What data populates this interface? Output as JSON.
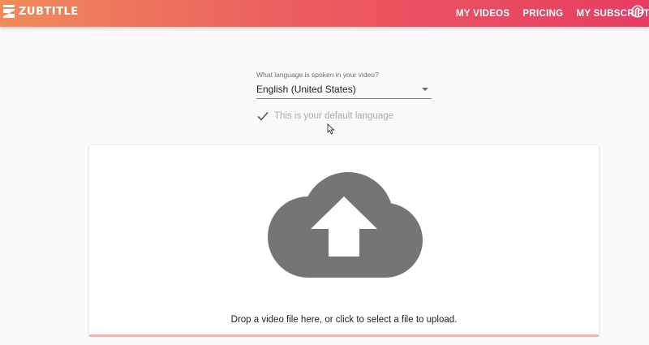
{
  "app": {
    "logo_text": "ZUBTITLE"
  },
  "nav": {
    "items": [
      "MY VIDEOS",
      "PRICING",
      "MY SUBSCRIPTION"
    ],
    "help_icon": "help-circle-icon"
  },
  "language": {
    "label": "What language is spoken in your video?",
    "selected": "English (United States)",
    "default_text": "This is your default language"
  },
  "upload": {
    "instruction": "Drop a video file here, or click to select a file to upload.",
    "icon": "cloud-upload-icon"
  },
  "colors": {
    "header_gradient_start": "#f08a5a",
    "header_gradient_end": "#e63d63",
    "icon_gray": "#757575"
  }
}
